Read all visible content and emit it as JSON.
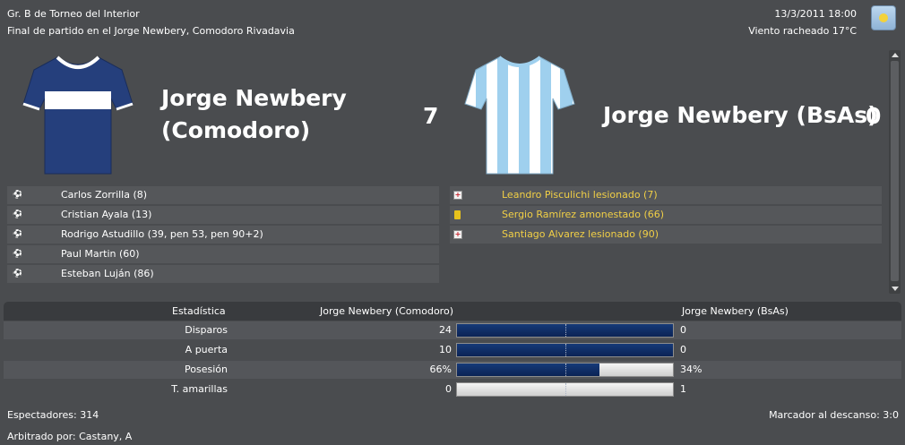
{
  "header": {
    "competition": "Gr. B de Torneo del Interior",
    "status": "Final de partido en el Jorge Newbery, Comodoro Rivadavia",
    "datetime": "13/3/2011 18:00",
    "weather": "Viento racheado 17°C",
    "weather_icon": "sun-weather-icon"
  },
  "home": {
    "name_line1": "Jorge Newbery",
    "name_line2": "(Comodoro)",
    "score": "7",
    "kit_colors": {
      "body": "#253f7c",
      "stripe": "#ffffff"
    },
    "events": [
      {
        "icon": "goal-ball-icon",
        "text": "Carlos Zorrilla (8)"
      },
      {
        "icon": "goal-ball-icon",
        "text": "Cristian Ayala (13)"
      },
      {
        "icon": "goal-ball-icon",
        "text": "Rodrigo Astudillo (39, pen 53, pen 90+2)"
      },
      {
        "icon": "goal-ball-icon",
        "text": "Paul Martin (60)"
      },
      {
        "icon": "goal-ball-icon",
        "text": "Esteban Luján (86)"
      }
    ]
  },
  "away": {
    "name": "Jorge Newbery (BsAs)",
    "score": "0",
    "kit_colors": {
      "stripe_a": "#9fd0ee",
      "stripe_b": "#ffffff"
    },
    "events": [
      {
        "icon": "injury-cross-icon",
        "text": "Leandro Pisculichi lesionado (7)"
      },
      {
        "icon": "yellow-card-icon",
        "text": "Sergio Ramírez amonestado (66)"
      },
      {
        "icon": "injury-cross-icon",
        "text": "Santiago Alvarez lesionado (90)"
      }
    ]
  },
  "stats": {
    "header": {
      "label": "Estadística",
      "home": "Jorge Newbery (Comodoro)",
      "away": "Jorge Newbery (BsAs)"
    },
    "rows": [
      {
        "label": "Disparos",
        "home": "24",
        "away": "0",
        "home_share": 1.0
      },
      {
        "label": "A puerta",
        "home": "10",
        "away": "0",
        "home_share": 1.0
      },
      {
        "label": "Posesión",
        "home": "66%",
        "away": "34%",
        "home_share": 0.66
      },
      {
        "label": "T. amarillas",
        "home": "0",
        "away": "1",
        "home_share": 0.0
      }
    ],
    "bar_color": "#0e2a60"
  },
  "footer": {
    "spectators": "Espectadores: 314",
    "halftime": "Marcador al descanso: 3:0",
    "referee": "Arbitrado por: Castany, A"
  }
}
